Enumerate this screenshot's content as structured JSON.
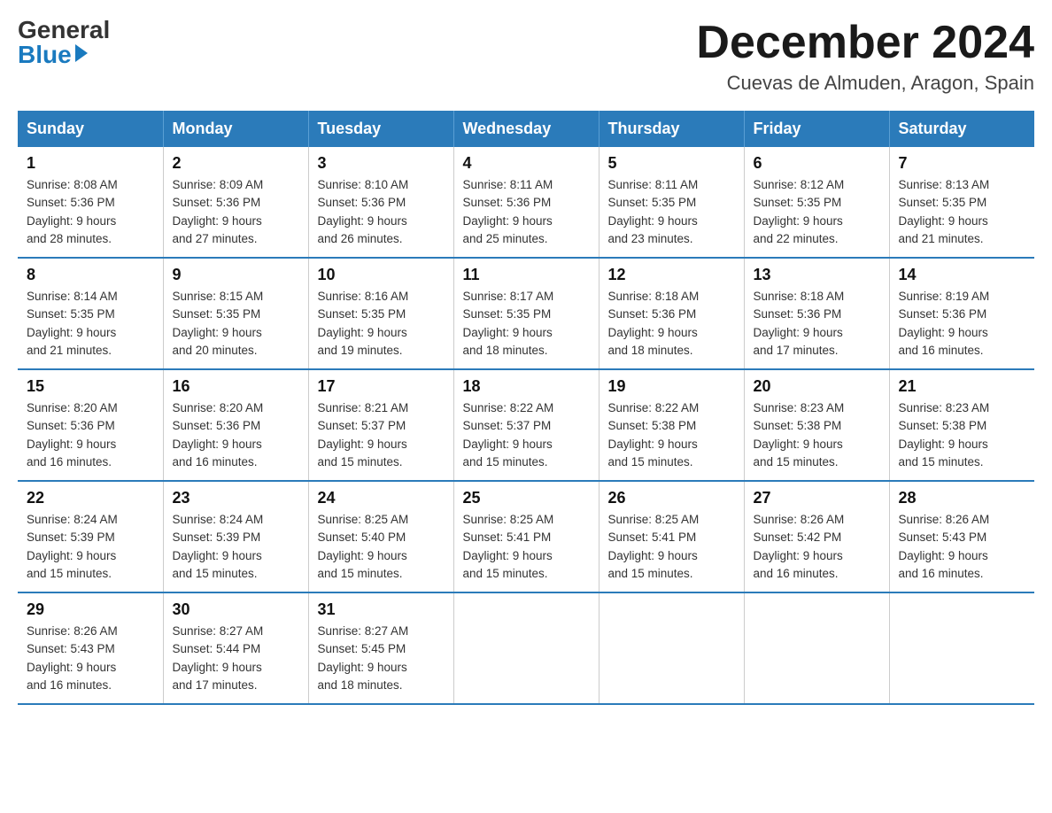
{
  "logo": {
    "general": "General",
    "blue": "Blue"
  },
  "title": {
    "month": "December 2024",
    "location": "Cuevas de Almuden, Aragon, Spain"
  },
  "days_header": [
    "Sunday",
    "Monday",
    "Tuesday",
    "Wednesday",
    "Thursday",
    "Friday",
    "Saturday"
  ],
  "weeks": [
    [
      {
        "day": "1",
        "sunrise": "8:08 AM",
        "sunset": "5:36 PM",
        "daylight": "9 hours and 28 minutes."
      },
      {
        "day": "2",
        "sunrise": "8:09 AM",
        "sunset": "5:36 PM",
        "daylight": "9 hours and 27 minutes."
      },
      {
        "day": "3",
        "sunrise": "8:10 AM",
        "sunset": "5:36 PM",
        "daylight": "9 hours and 26 minutes."
      },
      {
        "day": "4",
        "sunrise": "8:11 AM",
        "sunset": "5:36 PM",
        "daylight": "9 hours and 25 minutes."
      },
      {
        "day": "5",
        "sunrise": "8:11 AM",
        "sunset": "5:35 PM",
        "daylight": "9 hours and 23 minutes."
      },
      {
        "day": "6",
        "sunrise": "8:12 AM",
        "sunset": "5:35 PM",
        "daylight": "9 hours and 22 minutes."
      },
      {
        "day": "7",
        "sunrise": "8:13 AM",
        "sunset": "5:35 PM",
        "daylight": "9 hours and 21 minutes."
      }
    ],
    [
      {
        "day": "8",
        "sunrise": "8:14 AM",
        "sunset": "5:35 PM",
        "daylight": "9 hours and 21 minutes."
      },
      {
        "day": "9",
        "sunrise": "8:15 AM",
        "sunset": "5:35 PM",
        "daylight": "9 hours and 20 minutes."
      },
      {
        "day": "10",
        "sunrise": "8:16 AM",
        "sunset": "5:35 PM",
        "daylight": "9 hours and 19 minutes."
      },
      {
        "day": "11",
        "sunrise": "8:17 AM",
        "sunset": "5:35 PM",
        "daylight": "9 hours and 18 minutes."
      },
      {
        "day": "12",
        "sunrise": "8:18 AM",
        "sunset": "5:36 PM",
        "daylight": "9 hours and 18 minutes."
      },
      {
        "day": "13",
        "sunrise": "8:18 AM",
        "sunset": "5:36 PM",
        "daylight": "9 hours and 17 minutes."
      },
      {
        "day": "14",
        "sunrise": "8:19 AM",
        "sunset": "5:36 PM",
        "daylight": "9 hours and 16 minutes."
      }
    ],
    [
      {
        "day": "15",
        "sunrise": "8:20 AM",
        "sunset": "5:36 PM",
        "daylight": "9 hours and 16 minutes."
      },
      {
        "day": "16",
        "sunrise": "8:20 AM",
        "sunset": "5:36 PM",
        "daylight": "9 hours and 16 minutes."
      },
      {
        "day": "17",
        "sunrise": "8:21 AM",
        "sunset": "5:37 PM",
        "daylight": "9 hours and 15 minutes."
      },
      {
        "day": "18",
        "sunrise": "8:22 AM",
        "sunset": "5:37 PM",
        "daylight": "9 hours and 15 minutes."
      },
      {
        "day": "19",
        "sunrise": "8:22 AM",
        "sunset": "5:38 PM",
        "daylight": "9 hours and 15 minutes."
      },
      {
        "day": "20",
        "sunrise": "8:23 AM",
        "sunset": "5:38 PM",
        "daylight": "9 hours and 15 minutes."
      },
      {
        "day": "21",
        "sunrise": "8:23 AM",
        "sunset": "5:38 PM",
        "daylight": "9 hours and 15 minutes."
      }
    ],
    [
      {
        "day": "22",
        "sunrise": "8:24 AM",
        "sunset": "5:39 PM",
        "daylight": "9 hours and 15 minutes."
      },
      {
        "day": "23",
        "sunrise": "8:24 AM",
        "sunset": "5:39 PM",
        "daylight": "9 hours and 15 minutes."
      },
      {
        "day": "24",
        "sunrise": "8:25 AM",
        "sunset": "5:40 PM",
        "daylight": "9 hours and 15 minutes."
      },
      {
        "day": "25",
        "sunrise": "8:25 AM",
        "sunset": "5:41 PM",
        "daylight": "9 hours and 15 minutes."
      },
      {
        "day": "26",
        "sunrise": "8:25 AM",
        "sunset": "5:41 PM",
        "daylight": "9 hours and 15 minutes."
      },
      {
        "day": "27",
        "sunrise": "8:26 AM",
        "sunset": "5:42 PM",
        "daylight": "9 hours and 16 minutes."
      },
      {
        "day": "28",
        "sunrise": "8:26 AM",
        "sunset": "5:43 PM",
        "daylight": "9 hours and 16 minutes."
      }
    ],
    [
      {
        "day": "29",
        "sunrise": "8:26 AM",
        "sunset": "5:43 PM",
        "daylight": "9 hours and 16 minutes."
      },
      {
        "day": "30",
        "sunrise": "8:27 AM",
        "sunset": "5:44 PM",
        "daylight": "9 hours and 17 minutes."
      },
      {
        "day": "31",
        "sunrise": "8:27 AM",
        "sunset": "5:45 PM",
        "daylight": "9 hours and 18 minutes."
      },
      null,
      null,
      null,
      null
    ]
  ],
  "labels": {
    "sunrise": "Sunrise:",
    "sunset": "Sunset:",
    "daylight": "Daylight:"
  }
}
